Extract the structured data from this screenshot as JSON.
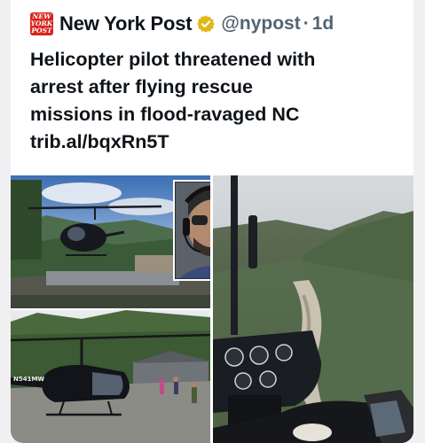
{
  "tweet": {
    "author_name": "New York Post",
    "handle": "@nypost",
    "separator": "·",
    "time": "1d",
    "logo_line1": "NEW",
    "logo_line2": "YORK",
    "logo_line3": "POST",
    "text_lines": [
      "Helicopter pilot threatened with",
      "arrest after flying rescue",
      "missions in flood-ravaged NC",
      "trib.al/bqxRn5T"
    ]
  },
  "colors": {
    "brand_red": "#d9241c",
    "verified_gold": "#e2b719",
    "text_primary": "#0f1419",
    "text_secondary": "#536471"
  },
  "icons": {
    "verified": "verified-badge-icon"
  },
  "media": {
    "panel_count": 4,
    "tail_number": "N541MW"
  }
}
